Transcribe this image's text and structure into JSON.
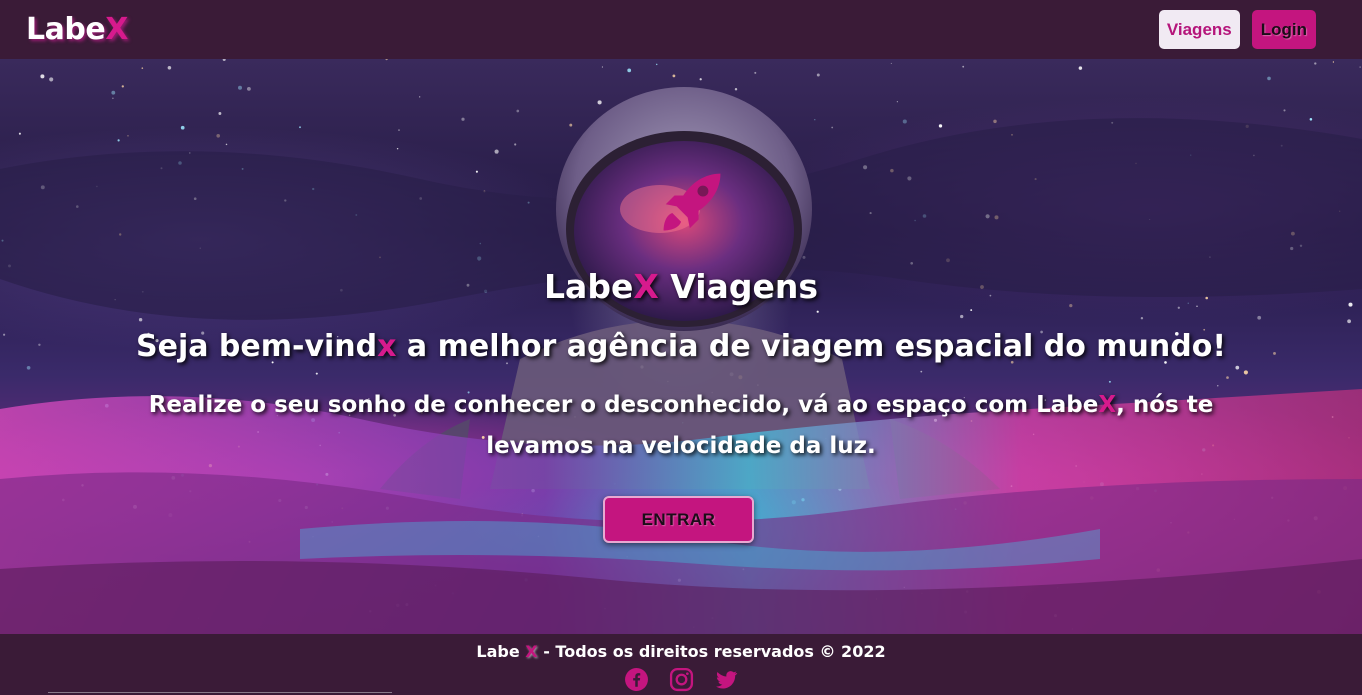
{
  "header": {
    "logo_main": "Labe",
    "logo_x": "X",
    "nav": {
      "viagens_label": "Viagens",
      "login_label": "Login"
    }
  },
  "hero": {
    "title_pre": "Labe",
    "title_x": "X",
    "title_post": " Viagens",
    "subtitle_pre": "Seja bem-vind",
    "subtitle_x": "x",
    "subtitle_post": " a melhor agência de viagem espacial do mundo!",
    "text_pre": "Realize o seu sonho de conhecer o desconhecido, vá ao espaço com Labe",
    "text_x": "X",
    "text_post": ", nós te levamos na velocidade da luz.",
    "button_label": "ENTRAR",
    "icon": "rocket-icon"
  },
  "footer": {
    "text_pre": "Labe ",
    "text_x": "X",
    "text_post": " - Todos os direitos reservados © 2022",
    "social": [
      "facebook-icon",
      "instagram-icon",
      "twitter-icon"
    ]
  },
  "colors": {
    "background": "#3a1b37",
    "accent": "#c4157f",
    "accent_light": "#d61a8d",
    "viagens_button_bg": "#f1eaf3"
  }
}
